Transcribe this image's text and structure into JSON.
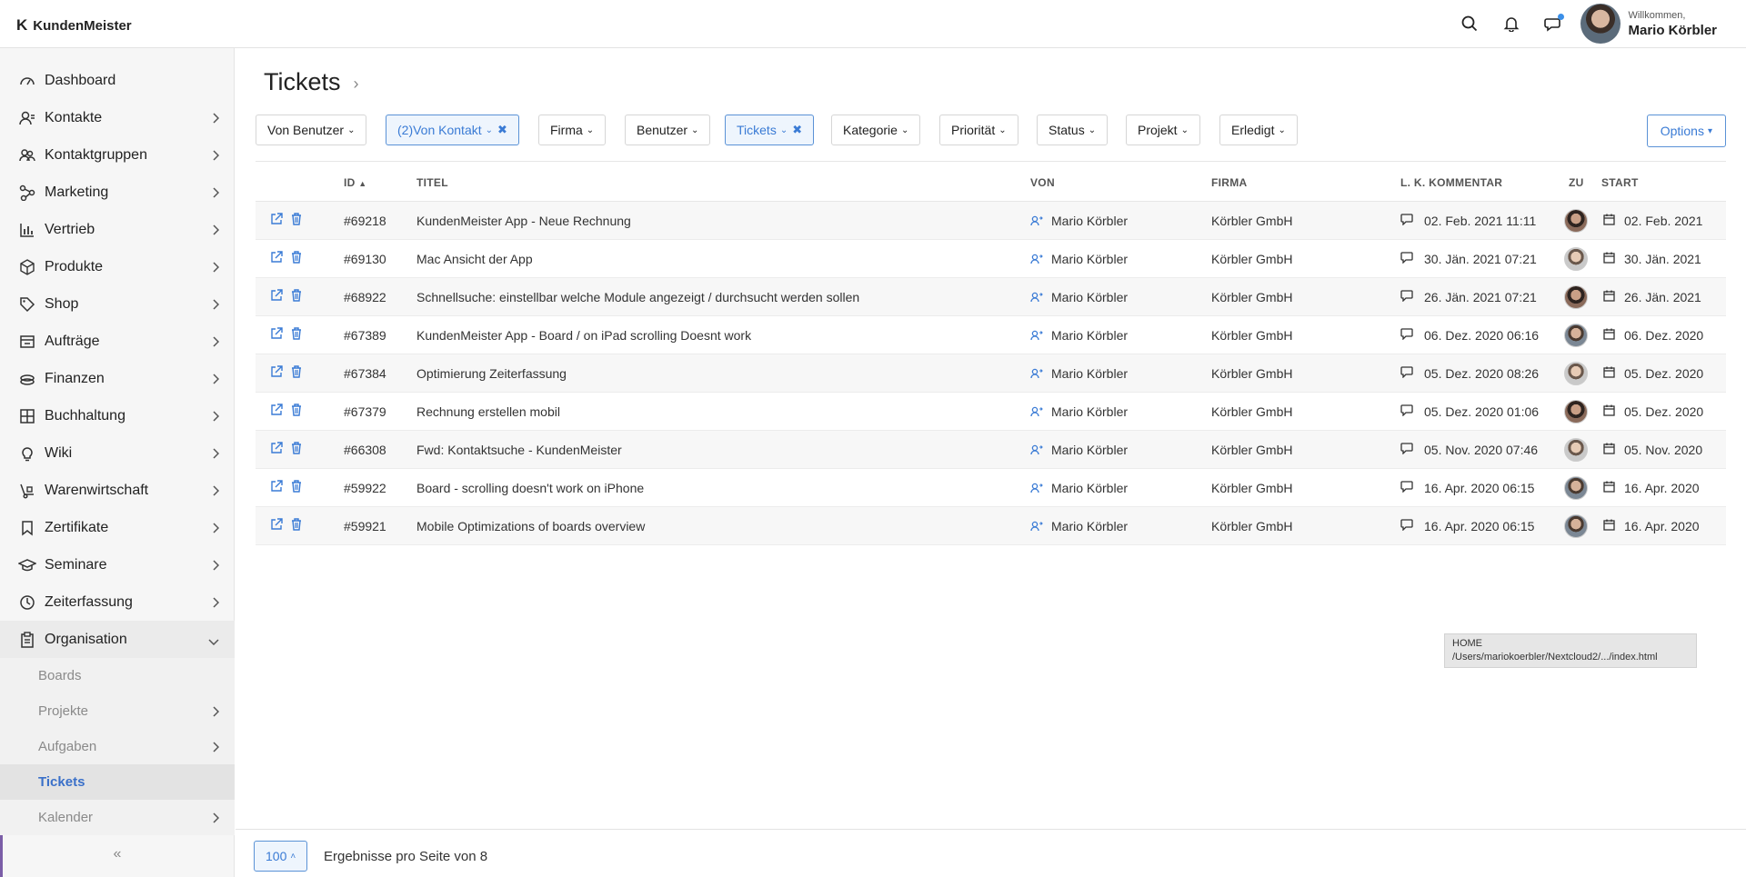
{
  "app": {
    "name": "KundenMeister"
  },
  "user": {
    "greeting": "Willkommen,",
    "name": "Mario Körbler"
  },
  "sidebar": {
    "items": [
      {
        "label": "Dashboard",
        "icon": "dashboard-icon"
      },
      {
        "label": "Kontakte",
        "icon": "contacts-icon"
      },
      {
        "label": "Kontaktgruppen",
        "icon": "groups-icon"
      },
      {
        "label": "Marketing",
        "icon": "share-icon"
      },
      {
        "label": "Vertrieb",
        "icon": "bar-chart-icon"
      },
      {
        "label": "Produkte",
        "icon": "box-icon"
      },
      {
        "label": "Shop",
        "icon": "tag-icon"
      },
      {
        "label": "Aufträge",
        "icon": "orders-icon"
      },
      {
        "label": "Finanzen",
        "icon": "coins-icon"
      },
      {
        "label": "Buchhaltung",
        "icon": "calculator-icon"
      },
      {
        "label": "Wiki",
        "icon": "bulb-icon"
      },
      {
        "label": "Warenwirtschaft",
        "icon": "handtruck-icon"
      },
      {
        "label": "Zertifikate",
        "icon": "bookmark-icon"
      },
      {
        "label": "Seminare",
        "icon": "graduation-cap-icon"
      },
      {
        "label": "Zeiterfassung",
        "icon": "clock-icon"
      },
      {
        "label": "Organisation",
        "icon": "clipboard-icon"
      }
    ],
    "sub": [
      {
        "label": "Boards"
      },
      {
        "label": "Projekte"
      },
      {
        "label": "Aufgaben"
      },
      {
        "label": "Tickets"
      },
      {
        "label": "Kalender"
      }
    ],
    "collapse_label": "«"
  },
  "page": {
    "title": "Tickets",
    "crumb": "›"
  },
  "filters": [
    {
      "label": "Von Benutzer",
      "active": false
    },
    {
      "label": "(2)Von Kontakt",
      "active": true
    },
    {
      "label": "Firma",
      "active": false
    },
    {
      "label": "Benutzer",
      "active": false
    },
    {
      "label": "Tickets",
      "active": true
    },
    {
      "label": "Kategorie",
      "active": false
    },
    {
      "label": "Priorität",
      "active": false
    },
    {
      "label": "Status",
      "active": false
    },
    {
      "label": "Projekt",
      "active": false
    },
    {
      "label": "Erledigt",
      "active": false
    }
  ],
  "options_label": "Options",
  "table": {
    "headers": {
      "id": "ID",
      "title": "TITEL",
      "von": "VON",
      "firma": "FIRMA",
      "kommentar": "L. K. KOMMENTAR",
      "zu": "ZU",
      "start": "START"
    },
    "rows": [
      {
        "id": "#69218",
        "title": "KundenMeister App - Neue Rechnung",
        "von": "Mario Körbler",
        "firma": "Körbler GmbH",
        "kommentar": "02. Feb. 2021 11:11",
        "start": "02. Feb. 2021"
      },
      {
        "id": "#69130",
        "title": "Mac Ansicht der App",
        "von": "Mario Körbler",
        "firma": "Körbler GmbH",
        "kommentar": "30. Jän. 2021 07:21",
        "start": "30. Jän. 2021"
      },
      {
        "id": "#68922",
        "title": "Schnellsuche: einstellbar welche Module angezeigt / durchsucht werden sollen",
        "von": "Mario Körbler",
        "firma": "Körbler GmbH",
        "kommentar": "26. Jän. 2021 07:21",
        "start": "26. Jän. 2021"
      },
      {
        "id": "#67389",
        "title": "KundenMeister App - Board / on iPad scrolling Doesnt work",
        "von": "Mario Körbler",
        "firma": "Körbler GmbH",
        "kommentar": "06. Dez. 2020 06:16",
        "start": "06. Dez. 2020"
      },
      {
        "id": "#67384",
        "title": "Optimierung Zeiterfassung",
        "von": "Mario Körbler",
        "firma": "Körbler GmbH",
        "kommentar": "05. Dez. 2020 08:26",
        "start": "05. Dez. 2020"
      },
      {
        "id": "#67379",
        "title": "Rechnung erstellen mobil",
        "von": "Mario Körbler",
        "firma": "Körbler GmbH",
        "kommentar": "05. Dez. 2020 01:06",
        "start": "05. Dez. 2020"
      },
      {
        "id": "#66308",
        "title": "Fwd: Kontaktsuche - KundenMeister",
        "von": "Mario Körbler",
        "firma": "Körbler GmbH",
        "kommentar": "05. Nov. 2020 07:46",
        "start": "05. Nov. 2020"
      },
      {
        "id": "#59922",
        "title": "Board - scrolling doesn't work on iPhone",
        "von": "Mario Körbler",
        "firma": "Körbler GmbH",
        "kommentar": "16. Apr. 2020 06:15",
        "start": "16. Apr. 2020"
      },
      {
        "id": "#59921",
        "title": "Mobile Optimizations of boards overview",
        "von": "Mario Körbler",
        "firma": "Körbler GmbH",
        "kommentar": "16. Apr. 2020 06:15",
        "start": "16. Apr. 2020"
      }
    ]
  },
  "tooltip": {
    "line1": "HOME",
    "line2": "/Users/mariokoerbler/Nextcloud2/.../index.html"
  },
  "footer": {
    "page_size": "100",
    "text": "Ergebnisse pro Seite von 8"
  },
  "colors": {
    "accent": "#3a7bd5",
    "active_sidebar": "#3a70c9"
  }
}
